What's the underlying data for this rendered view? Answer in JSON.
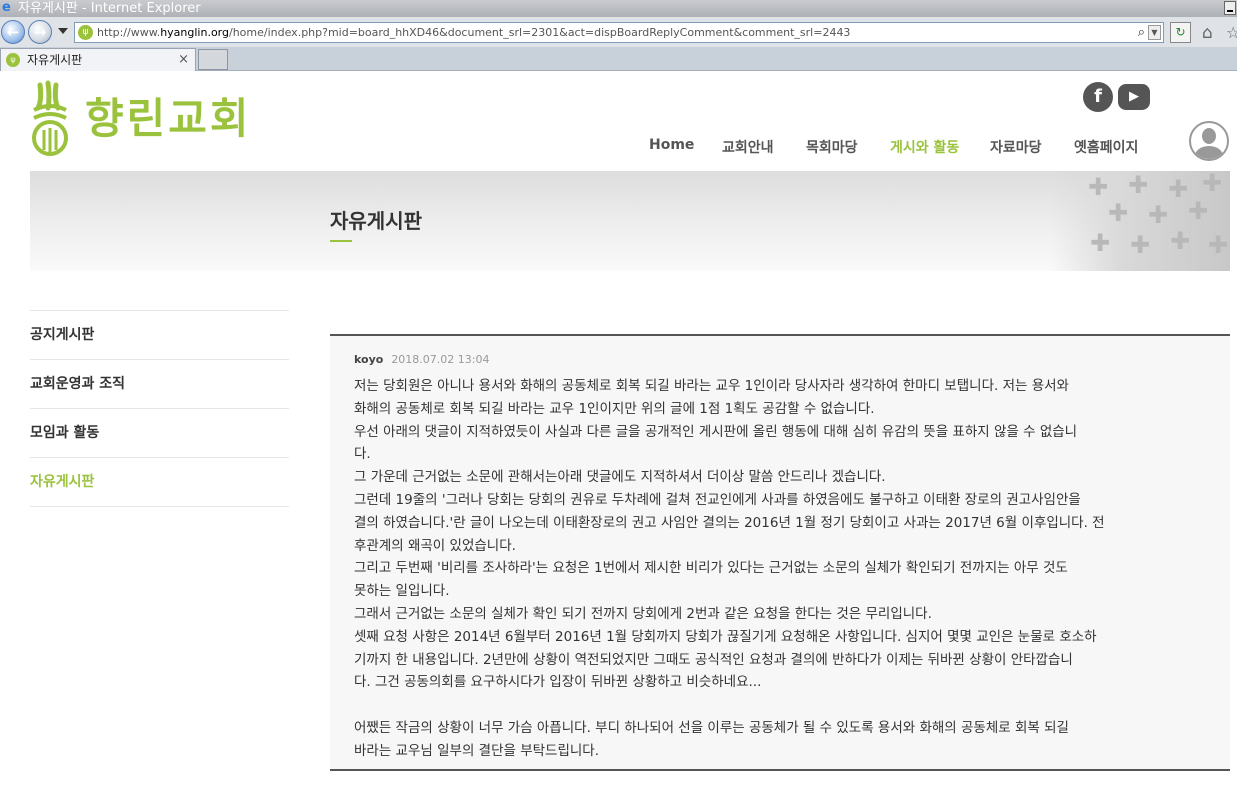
{
  "browser": {
    "window_title": "자유게시판 - Internet Explorer",
    "url_prefix": "http://www.",
    "url_domain": "hyanglin.org",
    "url_rest": "/home/index.php?mid=board_hhXD46&document_srl=2301&act=dispBoardReplyComment&comment_srl=2443",
    "tab_title": "자유게시판",
    "tab_close": "×",
    "icons": [
      "ie-logo-icon",
      "back-arrow-icon",
      "forward-arrow-icon",
      "search-icon",
      "refresh-icon",
      "home-icon",
      "star-icon"
    ]
  },
  "site": {
    "logo_text": "향린교회",
    "logo_color": "#9ac23c",
    "social": {
      "facebook": "f",
      "youtube": "▶"
    },
    "nav": [
      {
        "label": "Home",
        "active": false
      },
      {
        "label": "교회안내",
        "active": false
      },
      {
        "label": "목회마당",
        "active": false
      },
      {
        "label": "게시와 활동",
        "active": true
      },
      {
        "label": "자료마당",
        "active": false
      },
      {
        "label": "옛홈페이지",
        "active": false
      }
    ]
  },
  "banner": {
    "title": "자유게시판"
  },
  "sidebar": {
    "items": [
      {
        "label": "공지게시판",
        "active": false
      },
      {
        "label": "교회운영과 조직",
        "active": false
      },
      {
        "label": "모임과 활동",
        "active": false
      },
      {
        "label": "자유게시판",
        "active": true
      }
    ]
  },
  "comment": {
    "author": "koyo",
    "date": "2018.07.02 13:04",
    "lines": [
      "저는 당회원은 아니나 용서와 화해의 공동체로 회복 되길 바라는 교우 1인이라 당사자라 생각하여 한마디 보탭니다. 저는 용서와",
      "화해의 공동체로 회복 되길 바라는 교우 1인이지만 위의 글에 1점 1획도 공감할 수 없습니다.",
      "우선 아래의 댓글이 지적하였듯이 사실과 다른 글을 공개적인 게시판에 올린 행동에 대해 심히 유감의 뜻을 표하지 않을 수 없습니",
      "다.",
      "그 가운데 근거없는 소문에 관해서는아래 댓글에도 지적하셔서 더이상 말씀 안드리나 겠습니다.",
      "그런데 19줄의 '그러나 당회는 당회의 권유로 두차례에 걸쳐 전교인에게 사과를 하였음에도 불구하고 이태환 장로의 권고사임안을",
      "결의 하였습니다.'란 글이 나오는데 이태환장로의 권고 사임안 결의는 2016년 1월 정기 당회이고 사과는 2017년 6월 이후입니다. 전",
      "후관계의 왜곡이 있었습니다.",
      "그리고 두번째 '비리를 조사하라'는 요청은 1번에서 제시한 비리가 있다는 근거없는 소문의 실체가 확인되기 전까지는 아무 것도",
      "못하는 일입니다.",
      "그래서 근거없는 소문의 실체가 확인 되기 전까지 당회에게 2번과 같은 요청을 한다는 것은 무리입니다.",
      "셋째 요청 사항은 2014년 6월부터 2016년 1월 당회까지 당회가 끊질기게 요청해온 사항입니다. 심지어 몇몇 교인은 눈물로 호소하",
      "기까지 한 내용입니다. 2년만에 상황이 역전되었지만 그때도 공식적인 요청과 결의에 반하다가 이제는 뒤바뀐 상황이 안타깝습니",
      "다. 그건 공동의회를 요구하시다가 입장이 뒤바뀐 상황하고 비슷하네요...",
      "",
      "어쨌든 작금의 상황이 너무 가슴 아픕니다. 부디 하나되어 선을 이루는 공동체가 될 수 있도록 용서와 화해의 공동체로 회복 되길",
      "바라는 교우님 일부의 결단을 부탁드립니다."
    ]
  }
}
